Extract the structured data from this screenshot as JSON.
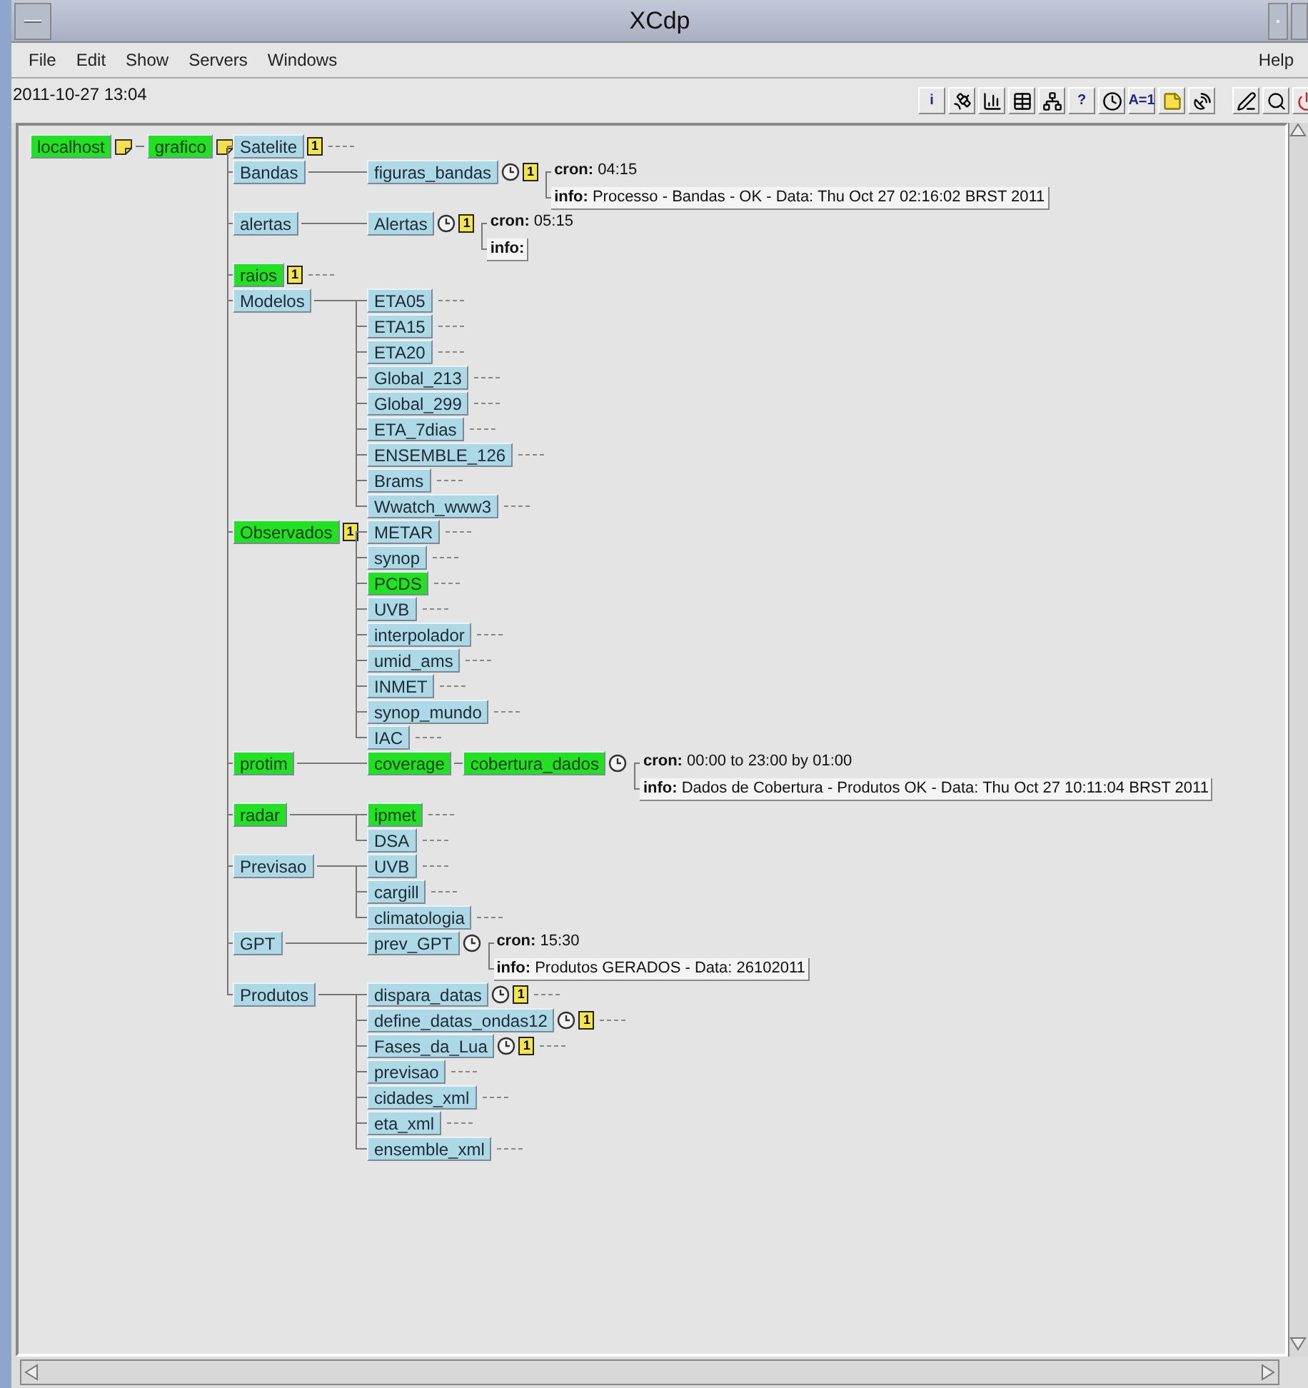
{
  "window": {
    "title": "XCdp"
  },
  "menu": [
    {
      "label": "File"
    },
    {
      "label": "Edit"
    },
    {
      "label": "Show"
    },
    {
      "label": "Servers"
    },
    {
      "label": "Windows"
    }
  ],
  "help": "Help",
  "status": {
    "datetime": "2011-10-27 13:04"
  },
  "toolbar": [
    {
      "kind": "text",
      "text": "i"
    },
    {
      "kind": "satellite"
    },
    {
      "kind": "bars"
    },
    {
      "kind": "table"
    },
    {
      "kind": "network"
    },
    {
      "kind": "text",
      "text": "?"
    },
    {
      "kind": "clock"
    },
    {
      "kind": "text",
      "text": "A=1"
    },
    {
      "kind": "note"
    },
    {
      "kind": "dish"
    },
    {
      "kind": "gap"
    },
    {
      "kind": "pen"
    },
    {
      "kind": "search"
    },
    {
      "kind": "power"
    }
  ],
  "tree": {
    "roots": [
      {
        "label": "localhost",
        "active": true,
        "note": true
      },
      {
        "label": "grafico",
        "active": true,
        "note": true
      }
    ],
    "children": [
      {
        "label": "Satelite",
        "active": false,
        "badge": "1"
      },
      {
        "label": "Bandas",
        "active": false,
        "children": [
          {
            "label": "figuras_bandas",
            "active": false,
            "clock": true,
            "badge": "1",
            "details": [
              {
                "key": "cron:",
                "value": "04:15",
                "boxed": false
              },
              {
                "key": "info:",
                "value": "Processo - Bandas - OK - Data: Thu Oct 27 02:16:02 BRST 2011",
                "boxed": true
              }
            ]
          }
        ]
      },
      {
        "label": "alertas",
        "active": false,
        "children": [
          {
            "label": "Alertas",
            "active": false,
            "clock": true,
            "badge": "1",
            "details": [
              {
                "key": "cron:",
                "value": "05:15",
                "boxed": false
              },
              {
                "key": "info:",
                "boxed": true
              }
            ]
          }
        ]
      },
      {
        "label": "raios",
        "active": true,
        "badge": "1"
      },
      {
        "label": "Modelos",
        "active": false,
        "children": [
          {
            "label": "ETA05",
            "active": false
          },
          {
            "label": "ETA15",
            "active": false
          },
          {
            "label": "ETA20",
            "active": false
          },
          {
            "label": "Global_213",
            "active": false
          },
          {
            "label": "Global_299",
            "active": false
          },
          {
            "label": "ETA_7dias",
            "active": false
          },
          {
            "label": "ENSEMBLE_126",
            "active": false
          },
          {
            "label": "Brams",
            "active": false
          },
          {
            "label": "Wwatch_www3",
            "active": false
          }
        ]
      },
      {
        "label": "Observados",
        "active": true,
        "badge": "1",
        "children": [
          {
            "label": "METAR",
            "active": false
          },
          {
            "label": "synop",
            "active": false
          },
          {
            "label": "PCDS",
            "active": true
          },
          {
            "label": "UVB",
            "active": false
          },
          {
            "label": "interpolador",
            "active": false
          },
          {
            "label": "umid_ams",
            "active": false
          },
          {
            "label": "INMET",
            "active": false
          },
          {
            "label": "synop_mundo",
            "active": false
          },
          {
            "label": "IAC",
            "active": false
          }
        ]
      },
      {
        "label": "protim",
        "active": true,
        "children": [
          {
            "label": "coverage",
            "active": true,
            "children": [
              {
                "label": "cobertura_dados",
                "active": true,
                "clock": true,
                "details": [
                  {
                    "key": "cron:",
                    "value": "00:00 to 23:00 by 01:00",
                    "boxed": false
                  },
                  {
                    "key": "info:",
                    "value": "Dados de Cobertura - Produtos OK - Data: Thu Oct 27 10:11:04 BRST 2011",
                    "boxed": true
                  }
                ]
              }
            ]
          }
        ]
      },
      {
        "label": "radar",
        "active": true,
        "children": [
          {
            "label": "ipmet",
            "active": true
          },
          {
            "label": "DSA",
            "active": false
          }
        ]
      },
      {
        "label": "Previsao",
        "active": false,
        "children": [
          {
            "label": "UVB",
            "active": false
          },
          {
            "label": "cargill",
            "active": false
          },
          {
            "label": "climatologia",
            "active": false
          }
        ]
      },
      {
        "label": "GPT",
        "active": false,
        "children": [
          {
            "label": "prev_GPT",
            "active": false,
            "clock": true,
            "details": [
              {
                "key": "cron:",
                "value": "15:30",
                "boxed": false
              },
              {
                "key": "info:",
                "value": "Produtos GERADOS - Data: 26102011",
                "boxed": true
              }
            ]
          }
        ]
      },
      {
        "label": "Produtos",
        "active": false,
        "children": [
          {
            "label": "dispara_datas",
            "active": false,
            "clock": true,
            "badge": "1"
          },
          {
            "label": "define_datas_ondas12",
            "active": false,
            "clock": true,
            "badge": "1"
          },
          {
            "label": "Fases_da_Lua",
            "active": false,
            "clock": true,
            "badge": "1"
          },
          {
            "label": "previsao",
            "active": false
          },
          {
            "label": "cidades_xml",
            "active": false
          },
          {
            "label": "eta_xml",
            "active": false
          },
          {
            "label": "ensemble_xml",
            "active": false
          }
        ]
      }
    ]
  }
}
